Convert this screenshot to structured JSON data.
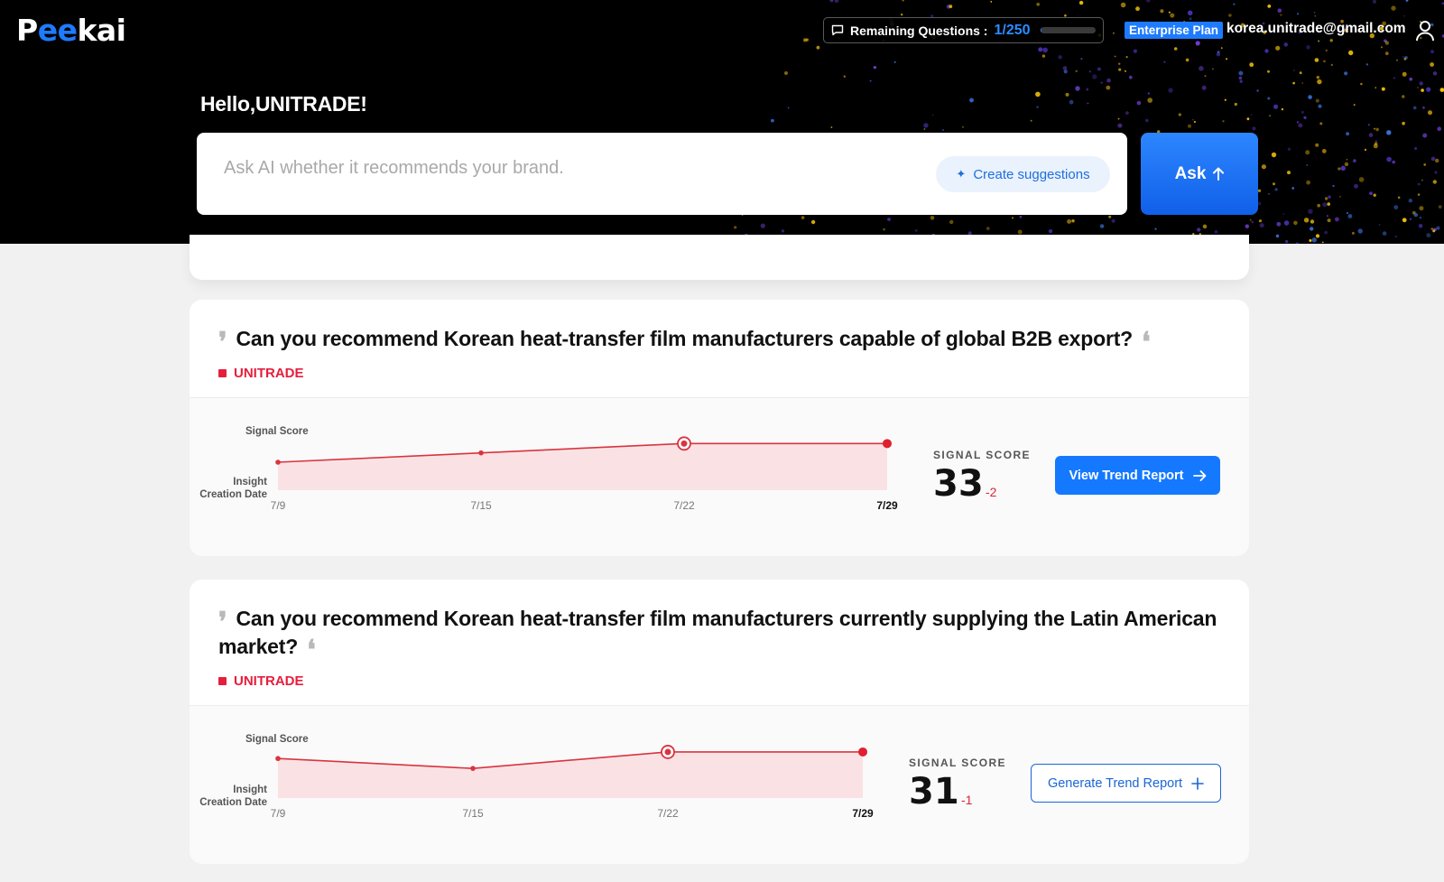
{
  "app": {
    "logo_prefix": "P",
    "logo_ee": "ee",
    "logo_suffix": "kai"
  },
  "header": {
    "remaining_label": "Remaining Questions :",
    "remaining_count": "1/250",
    "remaining_fraction": 0.004,
    "plan_badge": "Enterprise Plan",
    "email": "korea.unitrade@gmail.com",
    "greeting": "Hello,UNITRADE!"
  },
  "ask": {
    "placeholder": "Ask AI whether it recommends your brand.",
    "suggest_label": "Create suggestions",
    "ask_label": "Ask"
  },
  "colors": {
    "accent": "#1479ff",
    "brand_red": "#e61e3c",
    "line_red": "#d9343f"
  },
  "cards": [
    {
      "question": "Can you recommend Korean heat-transfer film manufacturers capable of global B2B export?",
      "brand": "UNITRADE",
      "signal_score_label": "SIGNAL SCORE",
      "score": "33",
      "delta": "-2",
      "button_label": "View Trend Report",
      "button_style": "primary",
      "chart_data": {
        "type": "area",
        "title": "",
        "ylabel": "Signal Score",
        "xlabel": "Insight Creation Date",
        "x": [
          "7/9",
          "7/15",
          "7/22",
          "7/29"
        ],
        "values": [
          31,
          33,
          35,
          35
        ],
        "highlight_index": 2,
        "ylim": [
          25,
          37
        ]
      }
    },
    {
      "question": "Can you recommend Korean heat-transfer film manufacturers currently supplying the Latin American market?",
      "brand": "UNITRADE",
      "signal_score_label": "SIGNAL SCORE",
      "score": "31",
      "delta": "-1",
      "button_label": "Generate Trend Report",
      "button_style": "outline",
      "chart_data": {
        "type": "area",
        "title": "",
        "ylabel": "Signal Score",
        "xlabel": "Insight Creation Date",
        "x": [
          "7/9",
          "7/15",
          "7/22",
          "7/29"
        ],
        "values": [
          32,
          29,
          34,
          34
        ],
        "highlight_index": 2,
        "ylim": [
          20,
          37
        ]
      }
    }
  ]
}
